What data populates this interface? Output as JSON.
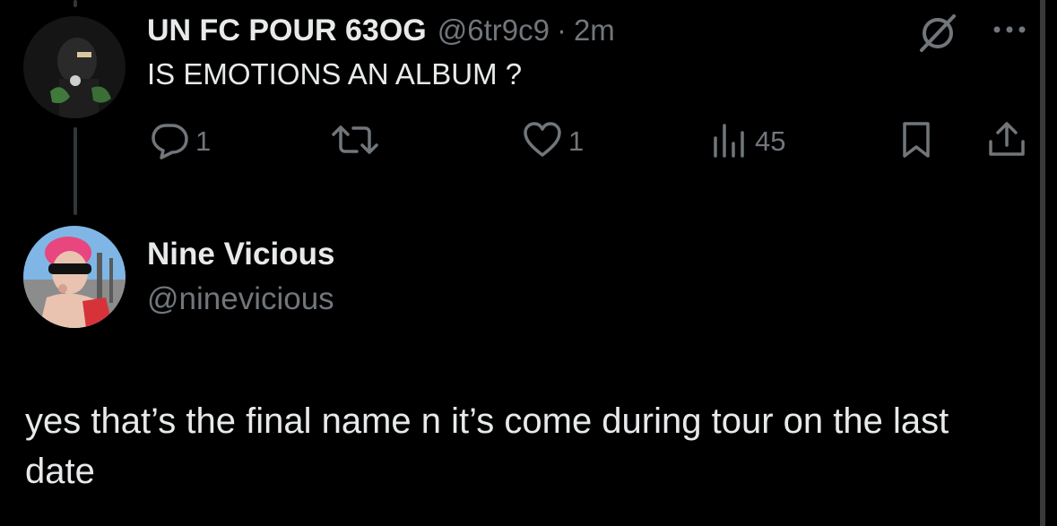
{
  "tweet": {
    "author": {
      "display_name": "UN FC POUR 63OG",
      "handle": "@6tr9c9",
      "separator": "·",
      "time": "2m"
    },
    "text": "IS EMOTIONS AN ALBUM ?",
    "actions": {
      "reply_count": "1",
      "retweet_count": "",
      "like_count": "1",
      "view_count": "45"
    }
  },
  "reply": {
    "display_name": "Nine Vicious",
    "handle": "@ninevicious",
    "text": "yes that’s the final name n it’s come during tour on the last date"
  },
  "colors": {
    "background": "#000000",
    "primary_text": "#e7e9ea",
    "secondary_text": "#71767b",
    "thread_line": "#333639"
  },
  "icons": [
    "no-entry-icon",
    "more-icon",
    "reply-icon",
    "retweet-icon",
    "like-icon",
    "views-icon",
    "bookmark-icon",
    "share-icon"
  ]
}
